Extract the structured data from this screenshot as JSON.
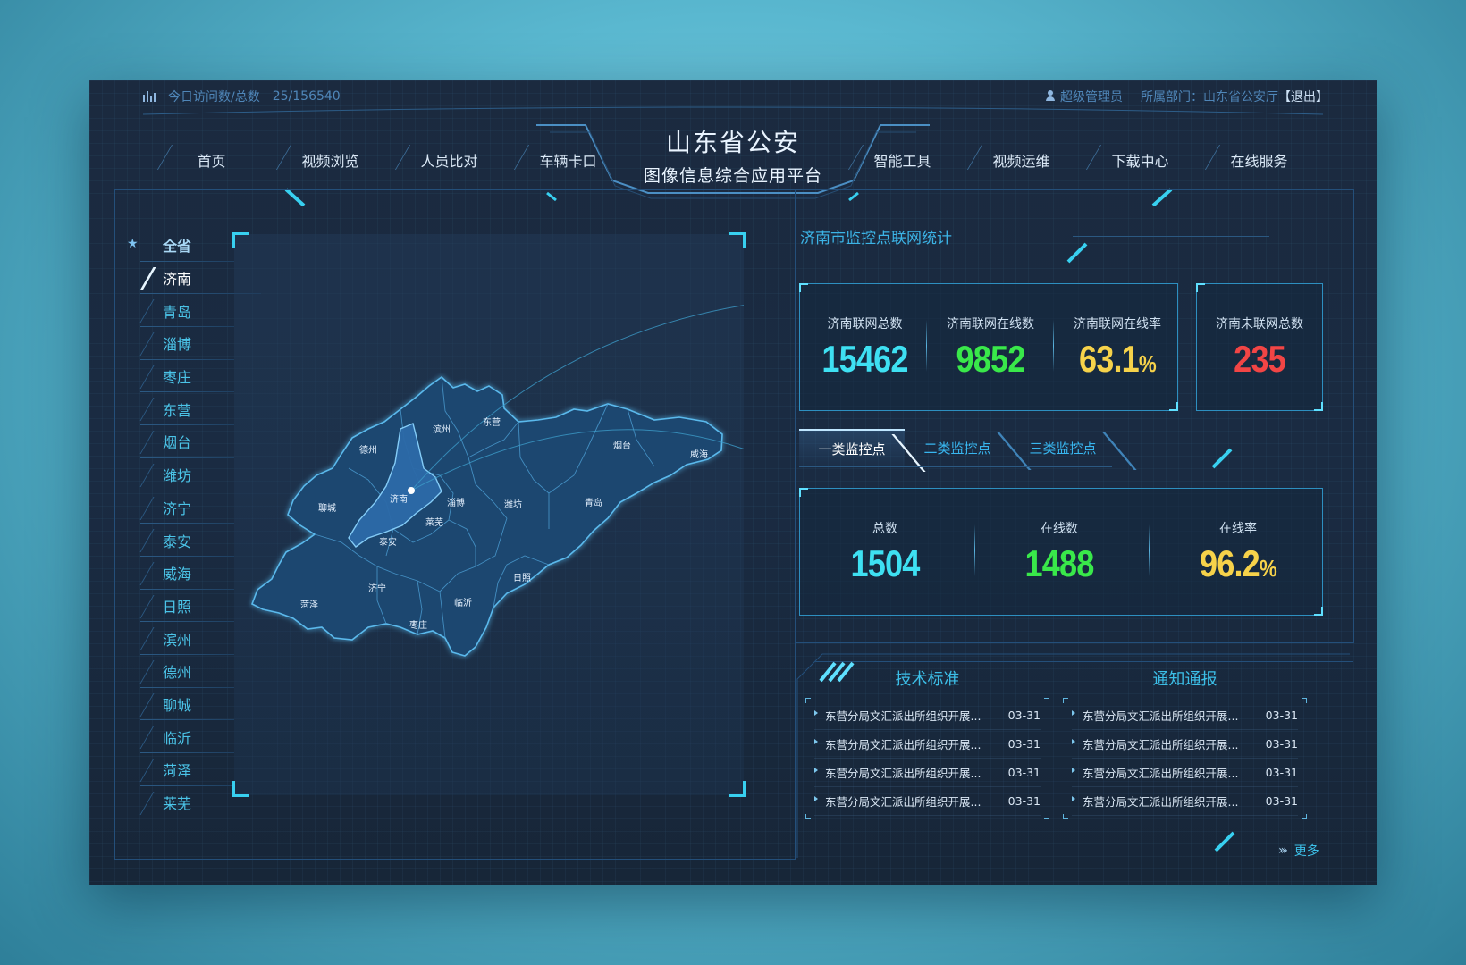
{
  "topbar": {
    "visits_label": "今日访问数/总数",
    "visits_value": "25/156540",
    "user_role": "超级管理员",
    "department": "所属部门：山东省公安厅",
    "logout": "【退出】"
  },
  "header": {
    "title": "山东省公安",
    "subtitle": "图像信息综合应用平台",
    "nav_left": [
      "首页",
      "视频浏览",
      "人员比对",
      "车辆卡口"
    ],
    "nav_right": [
      "智能工具",
      "视频运维",
      "下载中心",
      "在线服务"
    ]
  },
  "sidebar": {
    "all_label": "全省",
    "active_city": "济南",
    "cities": [
      "济南",
      "青岛",
      "淄博",
      "枣庄",
      "东营",
      "烟台",
      "潍坊",
      "济宁",
      "泰安",
      "威海",
      "日照",
      "滨州",
      "德州",
      "聊城",
      "临沂",
      "菏泽",
      "莱芜"
    ]
  },
  "map": {
    "labels": [
      "滨州",
      "东营",
      "德州",
      "烟台",
      "威海",
      "聊城",
      "济南",
      "淄博",
      "潍坊",
      "青岛",
      "莱芜",
      "泰安",
      "济宁",
      "日照",
      "菏泽",
      "临沂",
      "枣庄"
    ]
  },
  "stats": {
    "section_title": "济南市监控点联网统计",
    "total_label": "济南联网总数",
    "total_value": "15462",
    "online_label": "济南联网在线数",
    "online_value": "9852",
    "rate_label": "济南联网在线率",
    "rate_value": "63.1",
    "rate_unit": "%",
    "offline_label": "济南未联网总数",
    "offline_value": "235"
  },
  "tabs": {
    "items": [
      "一类监控点",
      "二类监控点",
      "三类监控点"
    ],
    "active_index": 0
  },
  "category_stats": {
    "total_label": "总数",
    "total_value": "1504",
    "online_label": "在线数",
    "online_value": "1488",
    "rate_label": "在线率",
    "rate_value": "96.2",
    "rate_unit": "%"
  },
  "panels": {
    "tech": {
      "title": "技术标准",
      "rows": [
        {
          "text": "东营分局文汇派出所组织开展...",
          "date": "03-31"
        },
        {
          "text": "东营分局文汇派出所组织开展...",
          "date": "03-31"
        },
        {
          "text": "东营分局文汇派出所组织开展...",
          "date": "03-31"
        },
        {
          "text": "东营分局文汇派出所组织开展...",
          "date": "03-31"
        }
      ]
    },
    "notice": {
      "title": "通知通报",
      "rows": [
        {
          "text": "东营分局文汇派出所组织开展...",
          "date": "03-31"
        },
        {
          "text": "东营分局文汇派出所组织开展...",
          "date": "03-31"
        },
        {
          "text": "东营分局文汇派出所组织开展...",
          "date": "03-31"
        },
        {
          "text": "东营分局文汇派出所组织开展...",
          "date": "03-31"
        }
      ]
    },
    "more_label": "更多"
  },
  "colors": {
    "cyan": "#3ee0f2",
    "green": "#39e84a",
    "yellow": "#f6d24a",
    "red": "#f24545",
    "accent": "#38d0f0"
  }
}
